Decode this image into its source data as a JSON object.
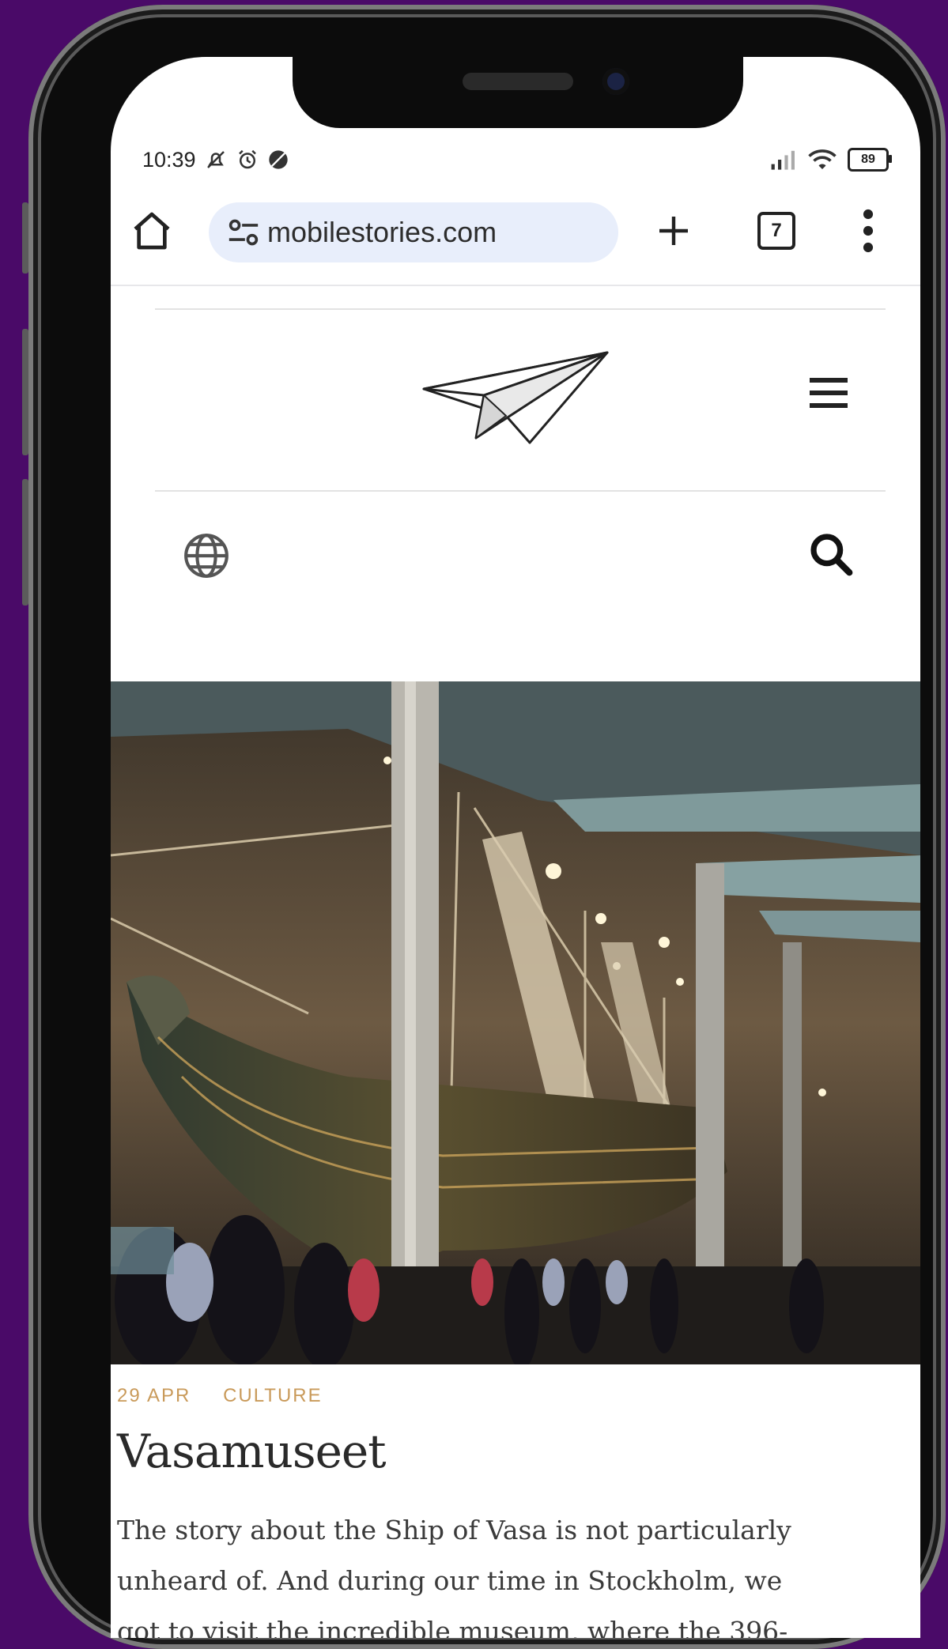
{
  "status_bar": {
    "time": "10:39",
    "battery": "89"
  },
  "browser": {
    "url": "mobilestories.com",
    "tab_count": "7"
  },
  "article": {
    "date": "29 APR",
    "category": "CULTURE",
    "title": "Vasamuseet",
    "excerpt_lines": [
      "The story about the Ship of Vasa is not particularly",
      "unheard of. And during our time in Stockholm, we",
      "got to visit the incredible museum, where the 396-"
    ]
  },
  "colors": {
    "background": "#4a0a68",
    "urlbar": "#e8eefb",
    "meta_accent": "#c99a5a"
  },
  "icons": [
    "home-icon",
    "site-settings-icon",
    "plus-icon",
    "tabs-icon",
    "more-vert-icon",
    "paper-plane-logo",
    "hamburger-menu-icon",
    "globe-icon",
    "search-icon",
    "silent-icon",
    "alarm-icon",
    "signal-icon",
    "wifi-icon",
    "battery-icon"
  ]
}
